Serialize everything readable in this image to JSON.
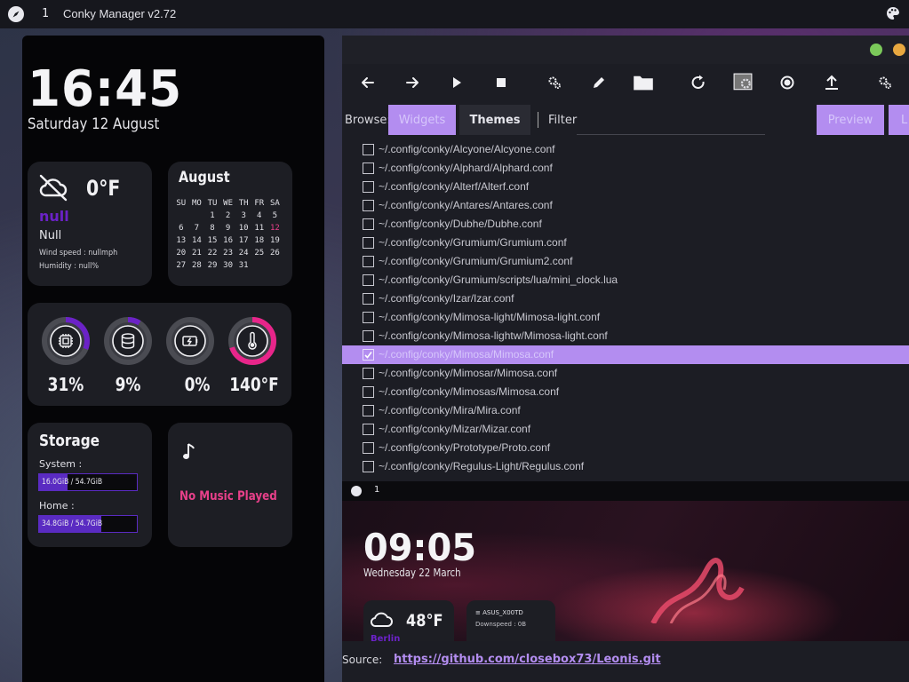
{
  "topbar": {
    "workspace": "1",
    "title": "Conky Manager v2.72"
  },
  "conky": {
    "time": "16:45",
    "date": "Saturday 12 August",
    "weather": {
      "temp": "0°F",
      "place": "null",
      "condition": "Null",
      "wind": "Wind speed : nullmph",
      "humidity": "Humidity : null%"
    },
    "calendar": {
      "month": "August",
      "headers": [
        "SU",
        "MO",
        "TU",
        "WE",
        "TH",
        "FR",
        "SA"
      ],
      "weeks": [
        [
          "",
          "",
          "1",
          "2",
          "3",
          "4",
          "5"
        ],
        [
          "6",
          "7",
          "8",
          "9",
          "10",
          "11",
          "12"
        ],
        [
          "13",
          "14",
          "15",
          "16",
          "17",
          "18",
          "19"
        ],
        [
          "20",
          "21",
          "22",
          "23",
          "24",
          "25",
          "26"
        ],
        [
          "27",
          "28",
          "29",
          "30",
          "31",
          "",
          ""
        ]
      ],
      "today": "12"
    },
    "gauges": [
      {
        "name": "cpu",
        "value": "31%",
        "fraction": 0.31,
        "color": "#6b22c7"
      },
      {
        "name": "disk",
        "value": "9%",
        "fraction": 0.09,
        "color": "#6b22c7"
      },
      {
        "name": "battery",
        "value": "0%",
        "fraction": 0.0,
        "color": "#6b22c7"
      },
      {
        "name": "temperature",
        "value": "140°F",
        "fraction": 0.7,
        "color": "#e8258a"
      }
    ],
    "storage": {
      "title": "Storage",
      "system_label": "System :",
      "system_value": "16.0GiB / 54.7GiB",
      "system_fraction": 0.29,
      "home_label": "Home :",
      "home_value": "34.8GiB / 54.7GiB",
      "home_fraction": 0.64
    },
    "music": {
      "text": "No Music Played"
    }
  },
  "manager": {
    "browse_label": "Browse:",
    "tabs": [
      "Widgets",
      "Themes"
    ],
    "filter_label": "Filter",
    "preview_button": "Preview",
    "second_button_partial": "L",
    "files": [
      {
        "path": "~/.config/conky/Alcyone/Alcyone.conf",
        "checked": false
      },
      {
        "path": "~/.config/conky/Alphard/Alphard.conf",
        "checked": false
      },
      {
        "path": "~/.config/conky/Alterf/Alterf.conf",
        "checked": false
      },
      {
        "path": "~/.config/conky/Antares/Antares.conf",
        "checked": false
      },
      {
        "path": "~/.config/conky/Dubhe/Dubhe.conf",
        "checked": false
      },
      {
        "path": "~/.config/conky/Grumium/Grumium.conf",
        "checked": false
      },
      {
        "path": "~/.config/conky/Grumium/Grumium2.conf",
        "checked": false
      },
      {
        "path": "~/.config/conky/Grumium/scripts/lua/mini_clock.lua",
        "checked": false
      },
      {
        "path": "~/.config/conky/Izar/Izar.conf",
        "checked": false
      },
      {
        "path": "~/.config/conky/Mimosa-light/Mimosa-light.conf",
        "checked": false
      },
      {
        "path": "~/.config/conky/Mimosa-lightw/Mimosa-light.conf",
        "checked": false
      },
      {
        "path": "~/.config/conky/Mimosa/Mimosa.conf",
        "checked": true
      },
      {
        "path": "~/.config/conky/Mimosar/Mimosa.conf",
        "checked": false
      },
      {
        "path": "~/.config/conky/Mimosas/Mimosa.conf",
        "checked": false
      },
      {
        "path": "~/.config/conky/Mira/Mira.conf",
        "checked": false
      },
      {
        "path": "~/.config/conky/Mizar/Mizar.conf",
        "checked": false
      },
      {
        "path": "~/.config/conky/Prototype/Proto.conf",
        "checked": false
      },
      {
        "path": "~/.config/conky/Regulus-Light/Regulus.conf",
        "checked": false
      }
    ],
    "preview": {
      "workspace": "1",
      "time": "09:05",
      "date": "Wednesday 22 March",
      "temp": "48°F",
      "place": "Berlin",
      "wifi": "ASUS_X00TD",
      "downspeed": "Downspeed : 0B"
    },
    "source_label": "Source:",
    "source_url": "https://github.com/closebox73/Leonis.git"
  },
  "colors": {
    "accent": "#b38df0",
    "purple": "#6b22c7",
    "pink": "#e8258a"
  }
}
